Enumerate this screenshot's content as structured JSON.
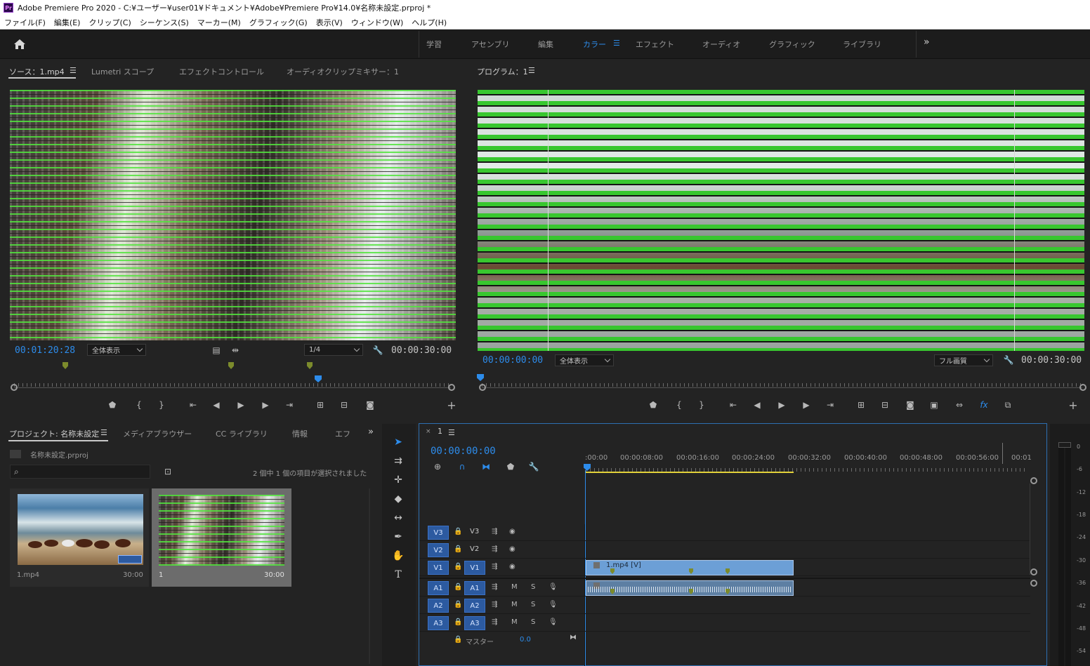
{
  "titlebar": {
    "logo": "Pr",
    "title": "Adobe Premiere Pro 2020 - C:¥ユーザー¥user01¥ドキュメント¥Adobe¥Premiere Pro¥14.0¥名称未設定.prproj *"
  },
  "menubar": {
    "items": [
      "ファイル(F)",
      "編集(E)",
      "クリップ(C)",
      "シーケンス(S)",
      "マーカー(M)",
      "グラフィック(G)",
      "表示(V)",
      "ウィンドウ(W)",
      "ヘルプ(H)"
    ]
  },
  "workspaces": {
    "tabs": [
      "学習",
      "アセンブリ",
      "編集",
      "カラー",
      "エフェクト",
      "オーディオ",
      "グラフィック",
      "ライブラリ"
    ],
    "active": "カラー",
    "more": "»"
  },
  "source_panel": {
    "tabs": [
      "ソース：1.mp4",
      "Lumetri スコープ",
      "エフェクトコントロール",
      "オーディオクリップミキサー：1"
    ],
    "timecode": "00:01:20:28",
    "fit": "全体表示",
    "resolution": "1/4",
    "duration": "00:00:30:00"
  },
  "program_panel": {
    "title": "プログラム：1",
    "timecode": "00:00:00:00",
    "fit": "全体表示",
    "quality": "フル画質",
    "duration": "00:00:30:00"
  },
  "project_panel": {
    "tabs": [
      "プロジェクト: 名称未設定",
      "メディアブラウザー",
      "CC ライブラリ",
      "情報",
      "エフ"
    ],
    "file": "名称未設定.prproj",
    "search_placeholder": "",
    "selection_status": "2 個中 1 個の項目が選択されました",
    "items": [
      {
        "name": "1.mp4",
        "duration": "30:00"
      },
      {
        "name": "1",
        "duration": "30:00"
      }
    ]
  },
  "timeline": {
    "sequence": "1",
    "timecode": "00:00:00:00",
    "ruler": [
      ":00:00",
      "00:00:08:00",
      "00:00:16:00",
      "00:00:24:00",
      "00:00:32:00",
      "00:00:40:00",
      "00:00:48:00",
      "00:00:56:00",
      "00:01"
    ],
    "video_tracks": [
      {
        "src": "V3",
        "name": "V3"
      },
      {
        "src": "V2",
        "name": "V2"
      },
      {
        "src": "V1",
        "name": "V1"
      }
    ],
    "audio_tracks": [
      {
        "src": "A1",
        "name": "A1"
      },
      {
        "src": "A2",
        "name": "A2"
      },
      {
        "src": "A3",
        "name": "A3"
      }
    ],
    "master_label": "マスター",
    "master_value": "0.0",
    "clip_label": "1.mp4 [V]",
    "mute": "M",
    "solo": "S"
  },
  "meter": {
    "labels": [
      "0",
      "-6",
      "-12",
      "-18",
      "-24",
      "-30",
      "-36",
      "-42",
      "-48",
      "-54"
    ]
  }
}
